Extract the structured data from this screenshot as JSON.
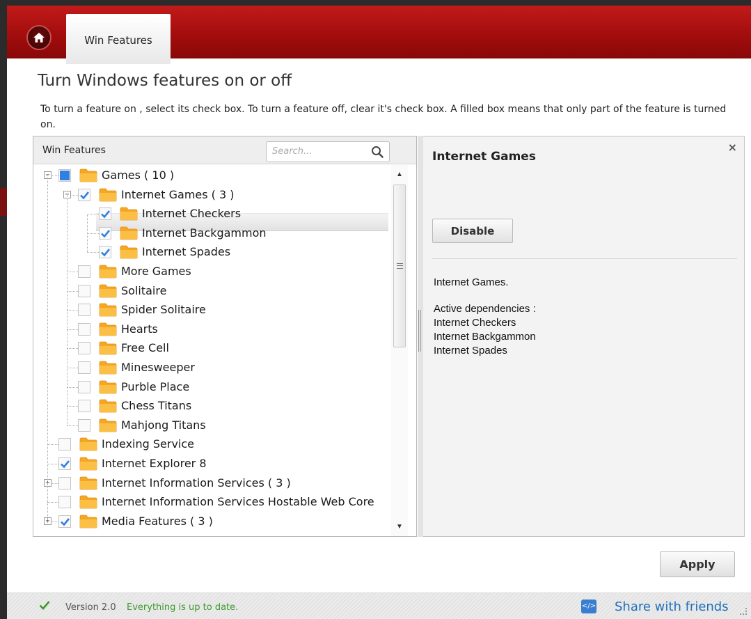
{
  "header": {
    "tab_label": "Win Features"
  },
  "page": {
    "title": "Turn Windows features on or off",
    "description": "To turn a feature on , select its check box. To turn a feature off, clear it's check box. A filled box means that only part of the feature is turned on."
  },
  "tree_panel": {
    "header_label": "Win Features",
    "search_placeholder": "Search...",
    "items": [
      {
        "label": "Games ( 10 )",
        "state": "partial",
        "expander": "minus"
      },
      {
        "label": "Internet Games ( 3 )",
        "state": "checked",
        "expander": "minus",
        "selected": true
      },
      {
        "label": "Internet Checkers",
        "state": "checked"
      },
      {
        "label": "Internet Backgammon",
        "state": "checked"
      },
      {
        "label": "Internet Spades",
        "state": "checked"
      },
      {
        "label": "More Games",
        "state": "unchecked"
      },
      {
        "label": "Solitaire",
        "state": "unchecked"
      },
      {
        "label": "Spider Solitaire",
        "state": "unchecked"
      },
      {
        "label": "Hearts",
        "state": "unchecked"
      },
      {
        "label": "Free Cell",
        "state": "unchecked"
      },
      {
        "label": "Minesweeper",
        "state": "unchecked"
      },
      {
        "label": "Purble Place",
        "state": "unchecked"
      },
      {
        "label": "Chess Titans",
        "state": "unchecked"
      },
      {
        "label": "Mahjong Titans",
        "state": "unchecked"
      },
      {
        "label": "Indexing Service",
        "state": "unchecked"
      },
      {
        "label": "Internet Explorer 8",
        "state": "checked"
      },
      {
        "label": "Internet Information Services ( 3 )",
        "state": "unchecked",
        "expander": "plus"
      },
      {
        "label": "Internet Information Services Hostable Web Core",
        "state": "unchecked"
      },
      {
        "label": "Media Features ( 3 )",
        "state": "checked",
        "expander": "plus"
      }
    ]
  },
  "detail_panel": {
    "title": "Internet Games",
    "disable_label": "Disable",
    "description": "Internet Games.",
    "dependencies_label": "Active dependencies :",
    "dependencies": [
      "Internet Checkers",
      "Internet Backgammon",
      "Internet Spades"
    ]
  },
  "actions": {
    "apply_label": "Apply"
  },
  "status": {
    "version": "Version 2.0",
    "message": "Everything is up to date.",
    "share_label": "Share with friends"
  },
  "colors": {
    "header_red": "#b01212",
    "checkbox_blue": "#2f80e0",
    "folder_orange": "#f5a623",
    "status_green": "#3a9a2a",
    "link_blue": "#1f6fba"
  }
}
